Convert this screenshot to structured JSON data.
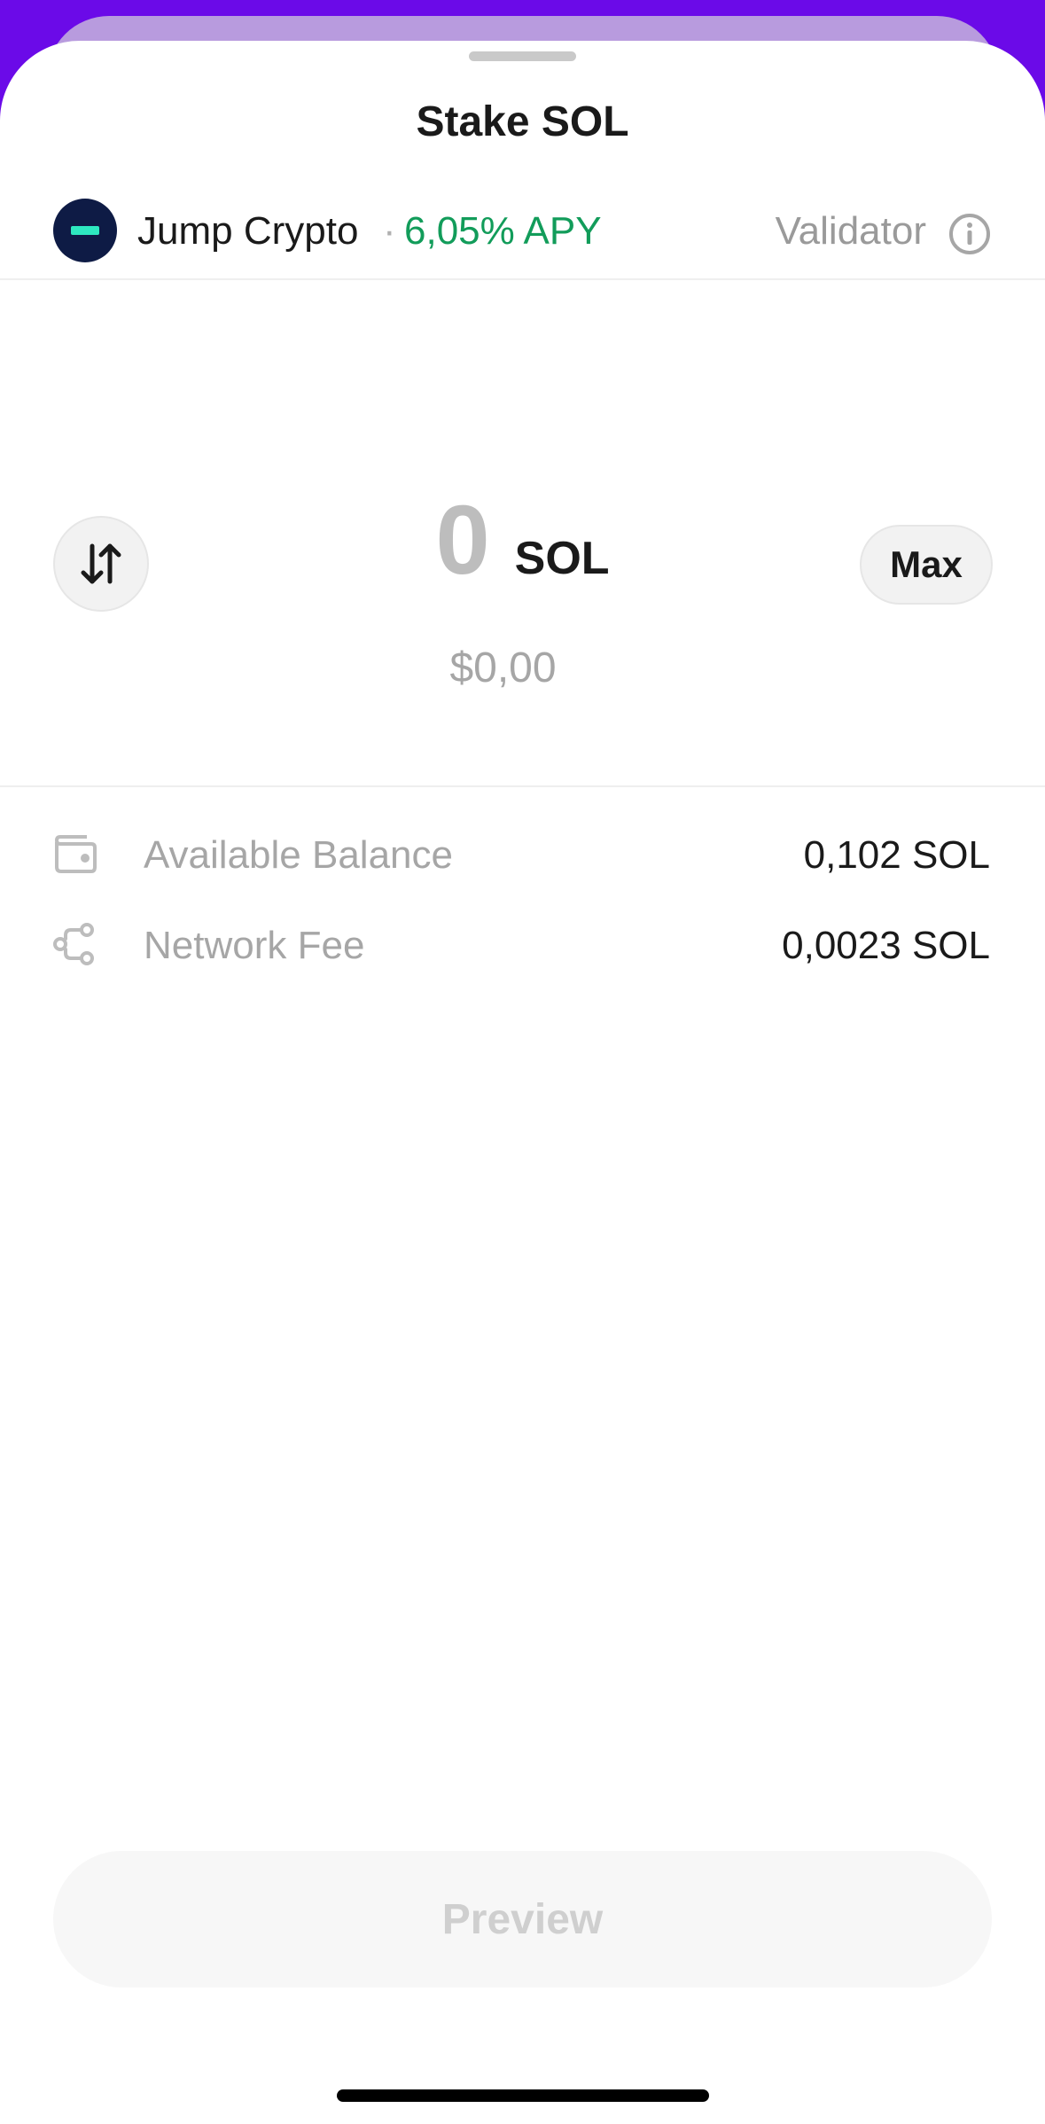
{
  "sheet": {
    "title": "Stake SOL"
  },
  "validator": {
    "name": "Jump Crypto",
    "separator": "·",
    "apy": "6,05% APY",
    "label": "Validator"
  },
  "amount": {
    "value": "0",
    "unit": "SOL",
    "fiat": "$0,00",
    "max_label": "Max"
  },
  "details": [
    {
      "icon": "wallet-icon",
      "label": "Available Balance",
      "value": "0,102 SOL"
    },
    {
      "icon": "network-icon",
      "label": "Network Fee",
      "value": "0,0023 SOL"
    }
  ],
  "footer": {
    "preview_label": "Preview"
  },
  "colors": {
    "accent_background": "#6B0AE8",
    "apy_green": "#129C5A",
    "validator_logo": "#0E1B45",
    "validator_logo_mark": "#2EE8C0"
  }
}
